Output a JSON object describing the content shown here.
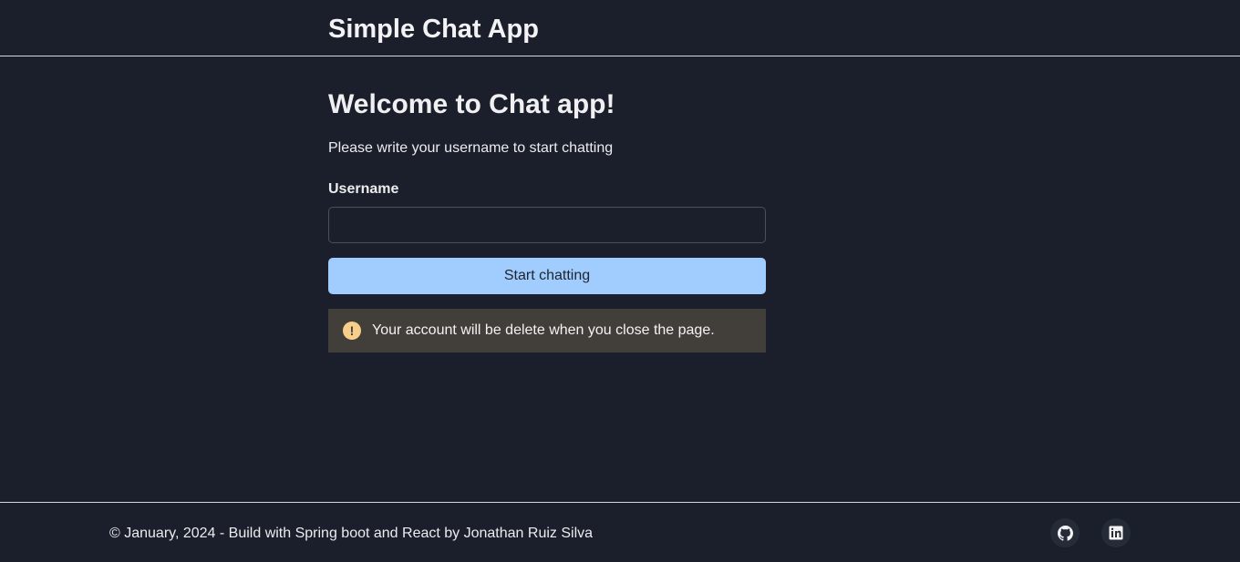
{
  "header": {
    "title": "Simple Chat App"
  },
  "main": {
    "welcome_title": "Welcome to Chat app!",
    "subtitle": "Please write your username to start chatting",
    "username_label": "Username",
    "username_value": "",
    "start_button_label": "Start chatting",
    "alert": {
      "icon": "exclamation-circle-icon",
      "text": "Your account will be delete when you close the page.",
      "icon_color": "#f8cf8a",
      "background": "#423f3b"
    }
  },
  "footer": {
    "text": "© January, 2024 - Build with Spring boot and React by Jonathan Ruiz Silva",
    "links": [
      {
        "icon": "github-icon"
      },
      {
        "icon": "linkedin-icon"
      }
    ]
  },
  "colors": {
    "background": "#1b1f2b",
    "accent": "#a0cdfd",
    "text": "#f0f0f2"
  }
}
